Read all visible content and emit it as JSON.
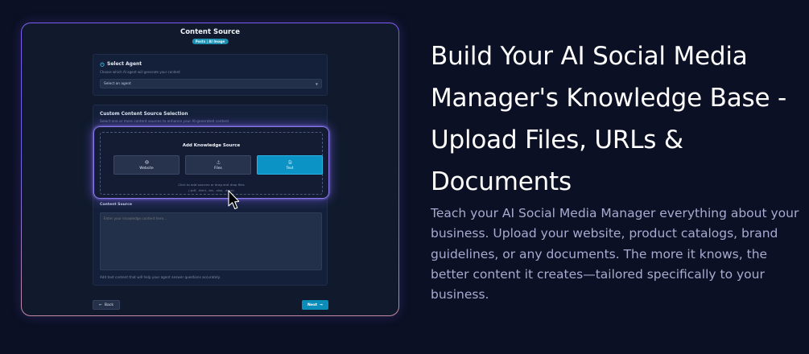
{
  "mockup": {
    "title": "Content Source",
    "badge": "Posts | AI Image",
    "agent": {
      "title": "Select Agent",
      "subtitle": "Choose which AI agent will generate your content",
      "select_value": "Select an agent"
    },
    "custom": {
      "title": "Custom Content Source Selection",
      "subtitle": "Select one or more content sources to enhance your AI-generated content"
    },
    "knowledge": {
      "title": "Add Knowledge Source",
      "buttons": [
        {
          "label": "Website",
          "icon": "globe-icon",
          "active": false
        },
        {
          "label": "Files",
          "icon": "upload-icon",
          "active": false
        },
        {
          "label": "Text",
          "icon": "document-icon",
          "active": true
        }
      ],
      "hint_line1": "Click to add sources or drag and drop files",
      "hint_line2": "(.pdf, .html, .txt, .xlsx, .docx)"
    },
    "content": {
      "label": "Content Source",
      "placeholder": "Enter your knowledge content here...",
      "helper": "Add text content that will help your agent answer questions accurately."
    },
    "nav": {
      "back_label": "Back",
      "next_label": "Next"
    }
  },
  "hero": {
    "headline": "Build Your AI Social Media Manager's Knowledge Base - Upload Files, URLs & Documents",
    "description": "Teach your AI Social Media Manager everything about your business. Upload your website, product catalogs, brand guidelines, or any documents. The more it knows, the better content it creates—tailored specifically to your business."
  },
  "colors": {
    "background": "#0c1024",
    "accent": "#0b93c6",
    "glow": "#8b78ef",
    "description_text": "#a6abd0"
  }
}
